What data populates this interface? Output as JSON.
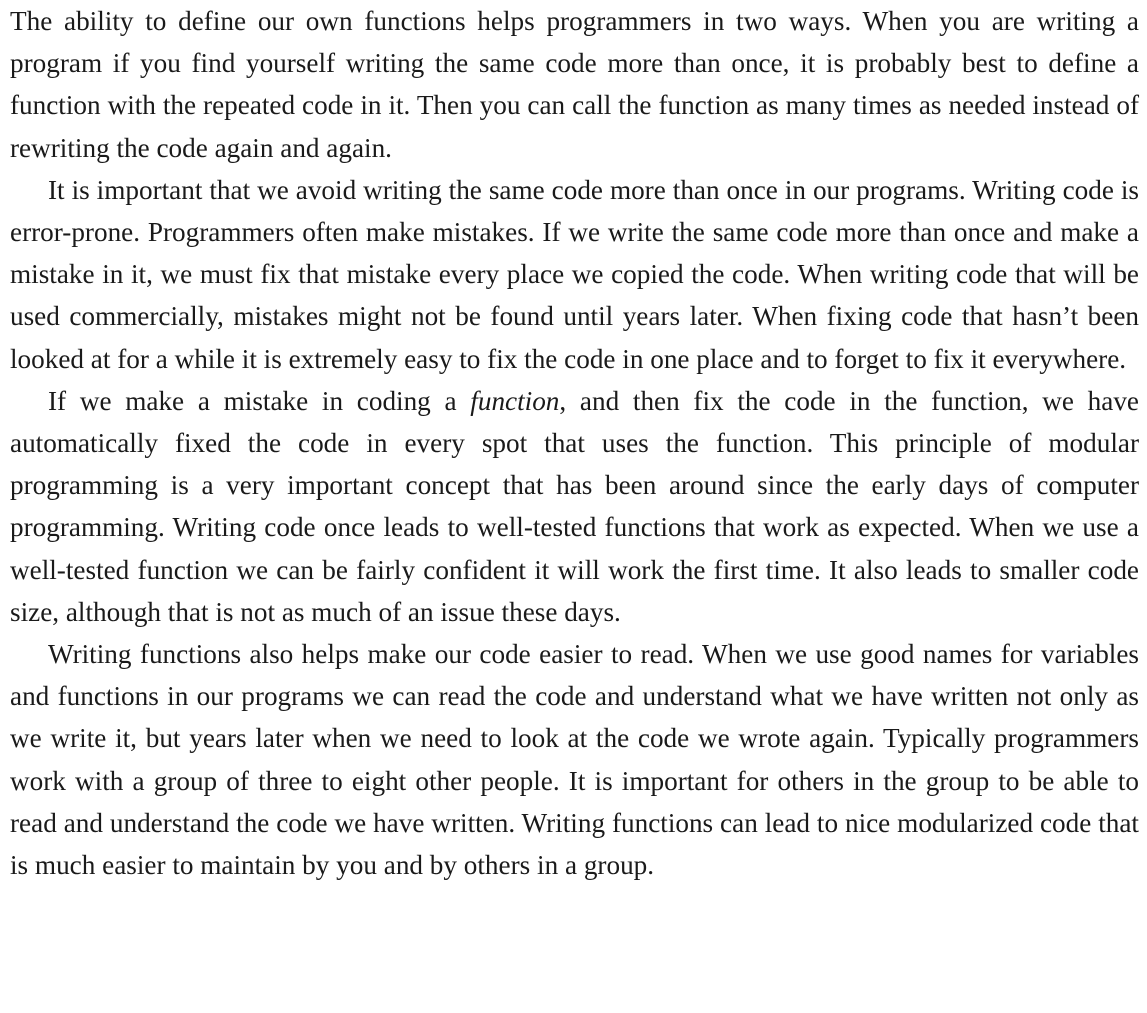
{
  "paragraphs": [
    {
      "text": "The ability to define our own functions helps programmers in two ways. When you are writing a program if you find yourself writing the same code more than once, it is probably best to define a function with the repeated code in it. Then you can call the function as many times as needed instead of rewriting the code again and again."
    },
    {
      "text": "It is important that we avoid writing the same code more than once in our programs. Writing code is error-prone. Programmers often make mistakes. If we write the same code more than once and make a mistake in it, we must fix that mistake every place we copied the code. When writing code that will be used commercially, mistakes might not be found until years later. When fixing code that hasn’t been looked at for a while it is extremely easy to fix the code in one place and to forget to fix it everywhere."
    },
    {
      "before": "If we make a mistake in coding a ",
      "emphasis": "function",
      "after": ", and then fix the code in the function, we have automatically fixed the code in every spot that uses the function. This principle of modular programming is a very important concept that has been around since the early days of computer programming. Writing code once leads to well-tested functions that work as expected. When we use a well-tested function we can be fairly confident it will work the first time. It also leads to smaller code size, although that is not as much of an issue these days."
    },
    {
      "text": "Writing functions also helps make our code easier to read. When we use good names for variables and functions in our programs we can read the code and understand what we have written not only as we write it, but years later when we need to look at the code we wrote again. Typically programmers work with a group of three to eight other people. It is important for others in the group to be able to read and understand the code we have written. Writing functions can lead to nice modularized code that is much easier to maintain by you and by others in a group."
    }
  ]
}
